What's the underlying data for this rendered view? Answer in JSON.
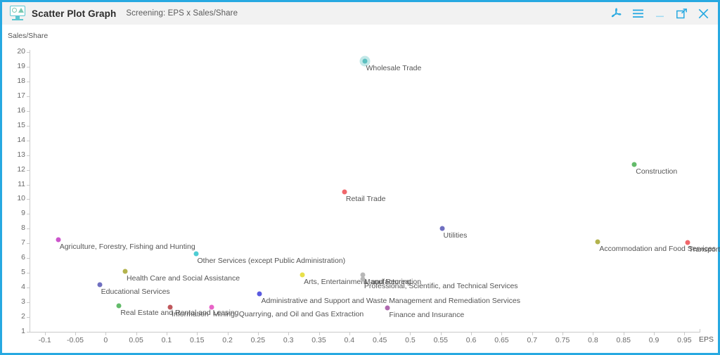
{
  "window": {
    "title": "Scatter Plot Graph",
    "subtitle": "Screening: EPS x Sales/Share",
    "app_icon": "chart-monitor-icon",
    "border_color": "#27a9e1",
    "titlebar_bg": "#f2f2f2"
  },
  "toolbar": {
    "buttons": [
      {
        "name": "pdf-export-icon",
        "label": "PDF"
      },
      {
        "name": "menu-icon",
        "label": "Menu"
      },
      {
        "name": "minimize-icon",
        "label": "Minimize"
      },
      {
        "name": "maximize-icon",
        "label": "Maximize"
      },
      {
        "name": "close-icon",
        "label": "Close"
      }
    ],
    "icon_color": "#27a9e1"
  },
  "chart_data": {
    "type": "scatter",
    "title": "Scatter Plot Graph",
    "subtitle": "Screening: EPS x Sales/Share",
    "xlabel": "EPS",
    "ylabel": "Sales/Share",
    "xlim": [
      -0.125,
      0.975
    ],
    "ylim": [
      1,
      20
    ],
    "grid": false,
    "legend": false,
    "xticks": [
      "-0.1",
      "-0.05",
      "0",
      "0.05",
      "0.1",
      "0.15",
      "0.2",
      "0.25",
      "0.3",
      "0.35",
      "0.4",
      "0.45",
      "0.5",
      "0.55",
      "0.6",
      "0.65",
      "0.7",
      "0.75",
      "0.8",
      "0.85",
      "0.9",
      "0.95"
    ],
    "yticks": [
      "20",
      "19",
      "18",
      "17",
      "16",
      "15",
      "14",
      "13",
      "12",
      "11",
      "10",
      "9",
      "8",
      "7",
      "6",
      "5",
      "4",
      "3",
      "2",
      "1"
    ],
    "points": [
      {
        "label": "Wholesale Trade",
        "x": 0.425,
        "y": 19.4,
        "color": "#5bbfbf",
        "selected": true
      },
      {
        "label": "Construction",
        "x": 0.868,
        "y": 12.35,
        "color": "#63bb6a",
        "selected": false
      },
      {
        "label": "Retail Trade",
        "x": 0.392,
        "y": 10.5,
        "color": "#f0676b",
        "selected": false
      },
      {
        "label": "Utilities",
        "x": 0.552,
        "y": 8.0,
        "color": "#6f6fc0",
        "selected": false
      },
      {
        "label": "Agriculture, Forestry, Fishing and Hunting",
        "x": -0.078,
        "y": 7.25,
        "color": "#cc55cc",
        "selected": false
      },
      {
        "label": "Accommodation and Food Services",
        "x": 0.808,
        "y": 7.1,
        "color": "#b3b34d",
        "selected": false
      },
      {
        "label": "Transportation and Warehousing",
        "x": 0.955,
        "y": 7.05,
        "color": "#f0676b",
        "selected": false
      },
      {
        "label": "Other Services (except Public Administration)",
        "x": 0.148,
        "y": 6.3,
        "color": "#4ecdd4",
        "selected": false
      },
      {
        "label": "Manufacturing",
        "x": 0.422,
        "y": 4.85,
        "color": "#b8b8b8",
        "selected": false
      },
      {
        "label": "Health Care and Social Assistance",
        "x": 0.032,
        "y": 5.1,
        "color": "#b3b34d",
        "selected": false
      },
      {
        "label": "Arts, Entertainment, and Recreation",
        "x": 0.323,
        "y": 4.85,
        "color": "#e8e04a",
        "selected": false
      },
      {
        "label": "Professional, Scientific, and Technical Services",
        "x": 0.422,
        "y": 4.6,
        "color": "#b8b8b8",
        "selected": false
      },
      {
        "label": "Educational Services",
        "x": -0.01,
        "y": 4.2,
        "color": "#6f6fc0",
        "selected": false
      },
      {
        "label": "Administrative and Support and Waste Management and Remediation Services",
        "x": 0.253,
        "y": 3.6,
        "color": "#5a5ae0",
        "selected": false
      },
      {
        "label": "Real Estate and Rental and Leasing",
        "x": 0.022,
        "y": 2.75,
        "color": "#63bb6a",
        "selected": false
      },
      {
        "label": "Information",
        "x": 0.106,
        "y": 2.65,
        "color": "#c0585c",
        "selected": false
      },
      {
        "label": "Mining, Quarrying, and Oil and Gas Extraction",
        "x": 0.174,
        "y": 2.65,
        "color": "#e864c8",
        "selected": false
      },
      {
        "label": "Finance and Insurance",
        "x": 0.463,
        "y": 2.6,
        "color": "#b06ab0",
        "selected": false
      }
    ]
  }
}
